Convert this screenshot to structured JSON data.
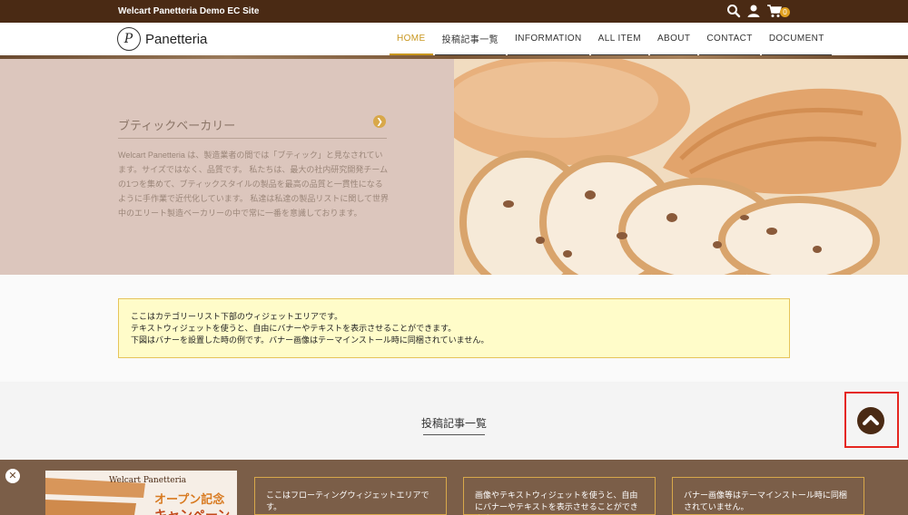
{
  "topbar": {
    "site_name": "Welcart Panetteria Demo EC Site",
    "cart_count": "0",
    "icons": [
      "search-icon",
      "user-icon",
      "cart-icon"
    ]
  },
  "header": {
    "logo_text": "Panetteria",
    "nav": [
      {
        "label": "HOME",
        "active": true
      },
      {
        "label": "投稿記事一覧"
      },
      {
        "label": "INFORMATION"
      },
      {
        "label": "ALL ITEM"
      },
      {
        "label": "ABOUT"
      },
      {
        "label": "CONTACT"
      },
      {
        "label": "DOCUMENT"
      }
    ]
  },
  "hero": {
    "title": "ブティックベーカリー",
    "body": "Welcart Panetteria は、製造業者の間では「ブティック」と見なされています。サイズではなく、品質です。 私たちは、最大の社内研究開発チームの1つを集めて、ブティックスタイルの製品を最高の品質と一貫性になるように手作業で近代化しています。 私達は私達の製品リストに関して世界中のエリート製造ベーカリーの中で常に一番を意識しております。"
  },
  "notice": {
    "lines": [
      "ここはカテゴリーリスト下部のウィジェットエリアです。",
      "テキストウィジェットを使うと、自由にバナーやテキストを表示させることができます。",
      "下図はバナーを設置した時の例です。バナー画像はテーマインストール時に同梱されていません。"
    ]
  },
  "posts": {
    "title": "投稿記事一覧"
  },
  "floating": {
    "banner_brand": "Welcart Panetteria",
    "banner_main": "オープン記念",
    "banner_sub": "キャンペーン",
    "boxes": [
      "ここはフローティングウィジェットエリアです。",
      "画像やテキストウィジェットを使うと、自由にバナーやテキストを表示させることができます。",
      "バナー画像等はテーマインストール時に同梱されていません。"
    ]
  },
  "colors": {
    "topbar": "#4a2a14",
    "accent": "#c8961e",
    "notice_bg": "#fffcc9",
    "highlight": "#e5261f"
  }
}
